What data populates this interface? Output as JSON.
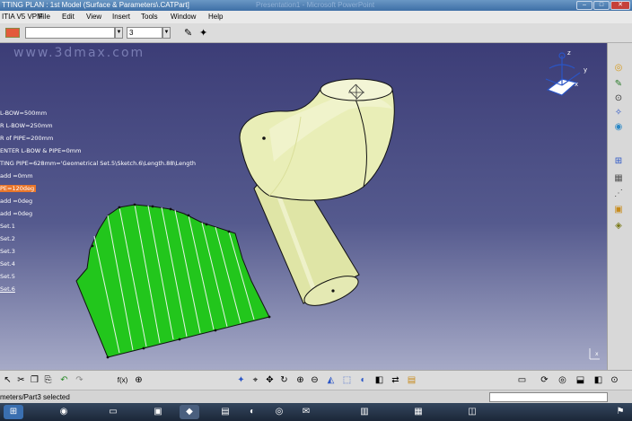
{
  "window": {
    "title": "TTING PLAN : 1st Model (Surface & Parameters\\.CATPart]",
    "ghost_title": "Presentation1 - Microsoft PowerPoint"
  },
  "menu": [
    "ITIA V5 VPM",
    "File",
    "Edit",
    "View",
    "Insert",
    "Tools",
    "Window",
    "Help"
  ],
  "toolbar": {
    "zoom_value": "3"
  },
  "watermark": "www.3dmax.com",
  "tree": [
    {
      "label": "L-BOW=500mm"
    },
    {
      "label": "R L-BOW=250mm"
    },
    {
      "label": "R of PIPE=200mm"
    },
    {
      "label": "ENTER L-BOW & PIPE=0mm"
    },
    {
      "label": "TING PIPE=628mm='Geometrical Set.5\\Sketch.6\\Length.88\\Length"
    },
    {
      "label": "add =0mm"
    },
    {
      "label": "PE=120deg",
      "selected": true
    },
    {
      "label": "add =0deg"
    },
    {
      "label": "add =0deg"
    },
    {
      "label": "Set.1"
    },
    {
      "label": "Set.2"
    },
    {
      "label": "Set.3"
    },
    {
      "label": "Set.4"
    },
    {
      "label": "Set.5"
    },
    {
      "label": "Set.6",
      "underline": true
    }
  ],
  "compass": {
    "x": "x",
    "y": "y",
    "z": "z"
  },
  "corner_axes": "x",
  "status": {
    "message": "meters/Part3 selected"
  },
  "colors": {
    "viewport_top": "#3c3d77",
    "surface_green": "#22c61c",
    "pipe_yellow": "#e9eeb7",
    "selected_param": "#e8762b"
  },
  "icons": {
    "right_toolbar": [
      "bubble-icon",
      "sketch-icon",
      "spline-icon",
      "wrench-icon",
      "circle-icon",
      "axis-icon",
      "grid-icon",
      "vertex-icon",
      "measure-icon",
      "analysis-icon"
    ],
    "bottom_toolbar": [
      "select-icon",
      "cut-icon",
      "copy-icon",
      "paste-icon",
      "undo-icon",
      "redo-icon",
      "formula-icon",
      "knowledge-icon",
      "pan-icon",
      "rotate-icon",
      "zoom-in-icon",
      "zoom-out-icon",
      "normal-view-icon",
      "iso-view-icon",
      "shading-icon",
      "hide-icon",
      "swap-icon",
      "measure-icon"
    ]
  }
}
